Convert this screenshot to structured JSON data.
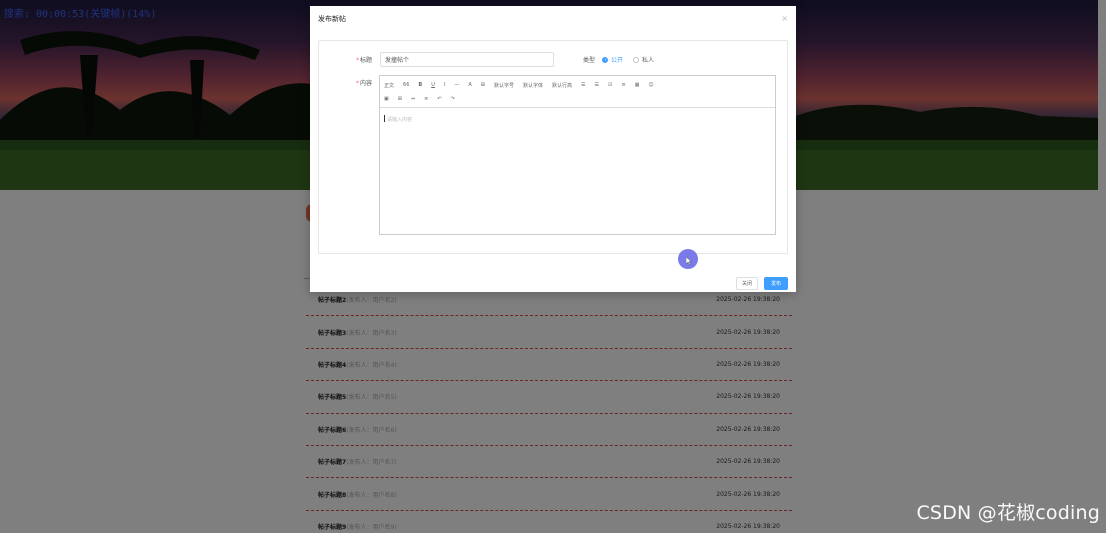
{
  "overlay_status": "搜索: 00:00:53(关键帧)(14%)",
  "dialog": {
    "title": "发布新帖",
    "close_glyph": "×",
    "title_field": {
      "label": "标题",
      "value": "发撞帖个"
    },
    "type_field": {
      "label": "类型",
      "options": [
        "公开",
        "私人"
      ],
      "selected": "公开"
    },
    "content_field": {
      "label": "内容",
      "placeholder": "请输入内容",
      "toolbar_row1": [
        "正文",
        "66",
        "B",
        "U",
        "I",
        "—",
        "A",
        "⊞",
        "默认字号",
        "默认字体",
        "默认行高",
        "☰",
        "☰",
        "☑",
        "≡",
        "▦",
        "☺"
      ],
      "toolbar_row2": [
        "▣",
        "⊞",
        "⇔",
        "≡",
        "↶",
        "↷"
      ]
    },
    "buttons": {
      "close": "关闭",
      "publish": "发布"
    }
  },
  "posts": [
    {
      "title": "帖子标题2",
      "author": "(发布人：用户名2)",
      "time": "2025-02-26 19:38:20"
    },
    {
      "title": "帖子标题3",
      "author": "(发布人：用户名3)",
      "time": "2025-02-26 19:38:20"
    },
    {
      "title": "帖子标题4",
      "author": "(发布人：用户名4)",
      "time": "2025-02-26 19:38:20"
    },
    {
      "title": "帖子标题5",
      "author": "(发布人：用户名5)",
      "time": "2025-02-26 19:38:20"
    },
    {
      "title": "帖子标题6",
      "author": "(发布人：用户名6)",
      "time": "2025-02-26 19:38:20"
    },
    {
      "title": "帖子标题7",
      "author": "(发布人：用户名7)",
      "time": "2025-02-26 19:38:20"
    },
    {
      "title": "帖子标题8",
      "author": "(发布人：用户名8)",
      "time": "2025-02-26 19:38:20"
    },
    {
      "title": "帖子标题9",
      "author": "(发布人：用户名9)",
      "time": "2025-02-26 19:38:20"
    }
  ],
  "watermark": "CSDN @花椒coding",
  "colors": {
    "accent": "#409eff",
    "required": "#f56c6c",
    "row_divider": "#d84a4a",
    "cursor": "#6c6ce6"
  }
}
